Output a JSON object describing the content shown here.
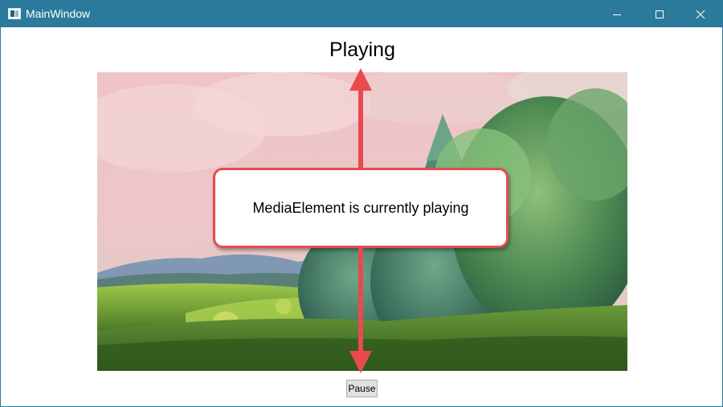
{
  "window": {
    "title": "MainWindow",
    "icon": "app-window-icon",
    "controls": {
      "minimize_icon": "minimize-icon",
      "maximize_icon": "maximize-icon",
      "close_icon": "close-icon"
    }
  },
  "status": {
    "label": "Playing"
  },
  "callout": {
    "text": "MediaElement is currently playing"
  },
  "controls": {
    "pause_label": "Pause"
  },
  "colors": {
    "titlebar": "#2b7a9b",
    "annotation": "#e84a4f"
  }
}
